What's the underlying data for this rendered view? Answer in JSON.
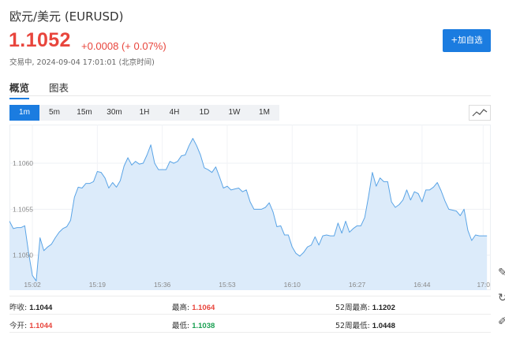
{
  "header": {
    "title": "欧元/美元 (EURUSD)",
    "price": "1.1052",
    "change": "+0.0008 (+ 0.07%)",
    "tone": "up",
    "status": "交易中, 2024-09-04 17:01:01 (北京时间)",
    "add_watchlist_label": "+加自选"
  },
  "tabs": {
    "items": [
      {
        "label": "概览",
        "active": true
      },
      {
        "label": "图表",
        "active": false
      }
    ]
  },
  "periods": {
    "items": [
      "1m",
      "5m",
      "15m",
      "30m",
      "1H",
      "4H",
      "1D",
      "1W",
      "1M"
    ],
    "active": "1m"
  },
  "chart_type_button": {
    "icon": "line-chart-icon"
  },
  "colors": {
    "up": "#e8453c",
    "down": "#1aa052",
    "neutral": "#222222",
    "accent": "#1b7ce0",
    "line": "#5aa4e6",
    "area": "#dcebfa"
  },
  "stats": [
    {
      "label": "昨收:",
      "value": "1.1044",
      "tone": "neutral"
    },
    {
      "label": "最高:",
      "value": "1.1064",
      "tone": "up"
    },
    {
      "label": "52周最高:",
      "value": "1.1202",
      "tone": "neutral"
    },
    {
      "label": "今开:",
      "value": "1.1044",
      "tone": "up"
    },
    {
      "label": "最低:",
      "value": "1.1038",
      "tone": "down"
    },
    {
      "label": "52周最低:",
      "value": "1.0448",
      "tone": "neutral"
    }
  ],
  "side_toolbar": {
    "icons": [
      "pencil-icon",
      "refresh-icon",
      "draw-icon"
    ]
  },
  "chart_data": {
    "type": "area",
    "x": [
      "14:56",
      "14:57",
      "14:58",
      "14:59",
      "15:00",
      "15:01",
      "15:02",
      "15:03",
      "15:04",
      "15:05",
      "15:06",
      "15:07",
      "15:08",
      "15:09",
      "15:10",
      "15:11",
      "15:12",
      "15:13",
      "15:14",
      "15:15",
      "15:16",
      "15:17",
      "15:18",
      "15:19",
      "15:20",
      "15:21",
      "15:22",
      "15:23",
      "15:24",
      "15:25",
      "15:26",
      "15:27",
      "15:28",
      "15:29",
      "15:30",
      "15:31",
      "15:32",
      "15:33",
      "15:34",
      "15:35",
      "15:36",
      "15:37",
      "15:38",
      "15:39",
      "15:40",
      "15:41",
      "15:42",
      "15:43",
      "15:44",
      "15:45",
      "15:46",
      "15:47",
      "15:48",
      "15:49",
      "15:50",
      "15:51",
      "15:52",
      "15:53",
      "15:54",
      "15:55",
      "15:56",
      "15:57",
      "15:58",
      "15:59",
      "16:00",
      "16:01",
      "16:02",
      "16:03",
      "16:04",
      "16:05",
      "16:06",
      "16:07",
      "16:08",
      "16:09",
      "16:10",
      "16:11",
      "16:12",
      "16:13",
      "16:14",
      "16:15",
      "16:16",
      "16:17",
      "16:18",
      "16:19",
      "16:20",
      "16:21",
      "16:22",
      "16:23",
      "16:24",
      "16:25",
      "16:26",
      "16:27",
      "16:28",
      "16:29",
      "16:30",
      "16:31",
      "16:32",
      "16:33",
      "16:34",
      "16:35",
      "16:36",
      "16:37",
      "16:38",
      "16:39",
      "16:40",
      "16:41",
      "16:42",
      "16:43",
      "16:44",
      "16:45",
      "16:46",
      "16:47",
      "16:48",
      "16:49",
      "16:50",
      "16:51",
      "16:52",
      "16:53",
      "16:54",
      "16:55",
      "16:56",
      "16:57",
      "16:58",
      "16:59",
      "17:00",
      "17:01"
    ],
    "series": [
      {
        "values": [
          1.10537,
          1.10529,
          1.1053,
          1.1053,
          1.10532,
          1.10503,
          1.10478,
          1.10472,
          1.10519,
          1.10505,
          1.10509,
          1.10512,
          1.10519,
          1.10525,
          1.10529,
          1.10531,
          1.10538,
          1.10563,
          1.10574,
          1.10573,
          1.10578,
          1.10578,
          1.1058,
          1.10591,
          1.1059,
          1.10584,
          1.10573,
          1.10579,
          1.10574,
          1.10581,
          1.10597,
          1.10606,
          1.10598,
          1.10602,
          1.10599,
          1.106,
          1.10609,
          1.1062,
          1.106,
          1.10593,
          1.10593,
          1.10593,
          1.10602,
          1.106,
          1.10602,
          1.10608,
          1.10609,
          1.10619,
          1.10627,
          1.10619,
          1.10609,
          1.10595,
          1.10593,
          1.1059,
          1.10596,
          1.10585,
          1.10573,
          1.10575,
          1.10571,
          1.10572,
          1.10573,
          1.10569,
          1.10571,
          1.10558,
          1.1055,
          1.1055,
          1.1055,
          1.10552,
          1.10557,
          1.10547,
          1.10531,
          1.10532,
          1.10522,
          1.10522,
          1.10509,
          1.10502,
          1.10499,
          1.10503,
          1.10509,
          1.10511,
          1.1052,
          1.10511,
          1.10521,
          1.10522,
          1.10521,
          1.10521,
          1.10535,
          1.10524,
          1.10537,
          1.10525,
          1.10529,
          1.10532,
          1.10532,
          1.10541,
          1.10564,
          1.1059,
          1.10575,
          1.10584,
          1.1058,
          1.1058,
          1.10558,
          1.10552,
          1.10555,
          1.1056,
          1.10571,
          1.1056,
          1.10569,
          1.10567,
          1.10558,
          1.10571,
          1.10571,
          1.10574,
          1.10579,
          1.1057,
          1.10559,
          1.1055,
          1.10549,
          1.10548,
          1.10543,
          1.1055,
          1.10527,
          1.10516,
          1.10522,
          1.10521,
          1.10521,
          1.10521
        ]
      }
    ],
    "x_ticks": [
      "15:02",
      "15:19",
      "15:36",
      "15:53",
      "16:10",
      "16:27",
      "16:44",
      "17:0"
    ],
    "y_ticks": [
      "1.1060",
      "1.1055",
      "1.1050"
    ],
    "xlim": [
      "14:56",
      "17:02"
    ],
    "ylim": [
      1.10462,
      1.10642
    ],
    "grid": true,
    "legend": "none"
  }
}
